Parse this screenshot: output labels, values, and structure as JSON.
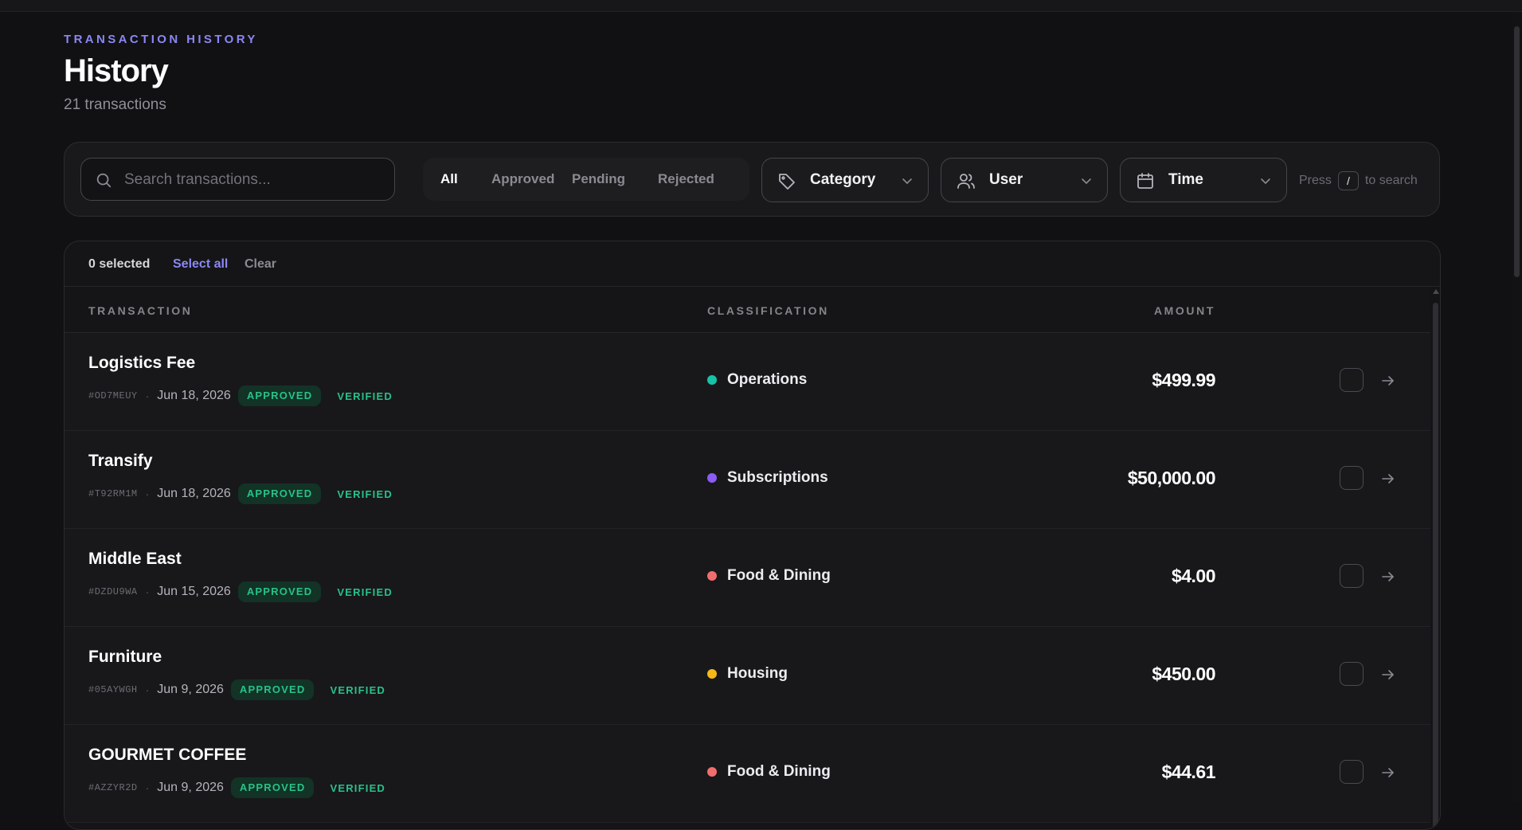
{
  "header": {
    "eyebrow": "TRANSACTION HISTORY",
    "title": "History",
    "subtitle": "21 transactions"
  },
  "filters": {
    "search_placeholder": "Search transactions...",
    "tabs": [
      {
        "label": "All",
        "active": true
      },
      {
        "label": "Approved",
        "active": false
      },
      {
        "label": "Pending",
        "active": false
      },
      {
        "label": "Rejected",
        "active": false
      }
    ],
    "category_label": "Category",
    "user_label": "User",
    "time_label": "Time",
    "hint_prefix": "Press",
    "hint_key": "/",
    "hint_suffix": "to search"
  },
  "selection": {
    "count_label": "0 selected",
    "select_all_label": "Select all",
    "clear_label": "Clear"
  },
  "table": {
    "columns": {
      "transaction": "TRANSACTION",
      "classification": "CLASSIFICATION",
      "amount": "AMOUNT"
    },
    "rows": [
      {
        "name": "Logistics Fee",
        "id": "#OD7MEUY",
        "sep": "·",
        "date": "Jun 18, 2026",
        "status": "APPROVED",
        "verification": "VERIFIED",
        "category": "Operations",
        "category_color": "#16c3a7",
        "amount": "$499.99"
      },
      {
        "name": "Transify",
        "id": "#T92RM1M",
        "sep": "·",
        "date": "Jun 18, 2026",
        "status": "APPROVED",
        "verification": "VERIFIED",
        "category": "Subscriptions",
        "category_color": "#8b5cf6",
        "amount": "$50,000.00"
      },
      {
        "name": "Middle East",
        "id": "#DZDU9WA",
        "sep": "·",
        "date": "Jun 15, 2026",
        "status": "APPROVED",
        "verification": "VERIFIED",
        "category": "Food & Dining",
        "category_color": "#f26d6d",
        "amount": "$4.00"
      },
      {
        "name": "Furniture",
        "id": "#05AYWGH",
        "sep": "·",
        "date": "Jun 9, 2026",
        "status": "APPROVED",
        "verification": "VERIFIED",
        "category": "Housing",
        "category_color": "#f5b917",
        "amount": "$450.00"
      },
      {
        "name": "GOURMET COFFEE",
        "id": "#AZZYR2D",
        "sep": "·",
        "date": "Jun 9, 2026",
        "status": "APPROVED",
        "verification": "VERIFIED",
        "category": "Food & Dining",
        "category_color": "#f26d6d",
        "amount": "$44.61"
      }
    ]
  },
  "icons": {
    "search": "search-icon",
    "category": "tag-icon",
    "user": "users-icon",
    "time": "calendar-icon",
    "dropdown": "chevron-down-icon",
    "row_action": "arrow-right-icon"
  },
  "colors": {
    "accent": "#8b87f5",
    "status_approved": "#27c28a",
    "background": "#111113"
  }
}
